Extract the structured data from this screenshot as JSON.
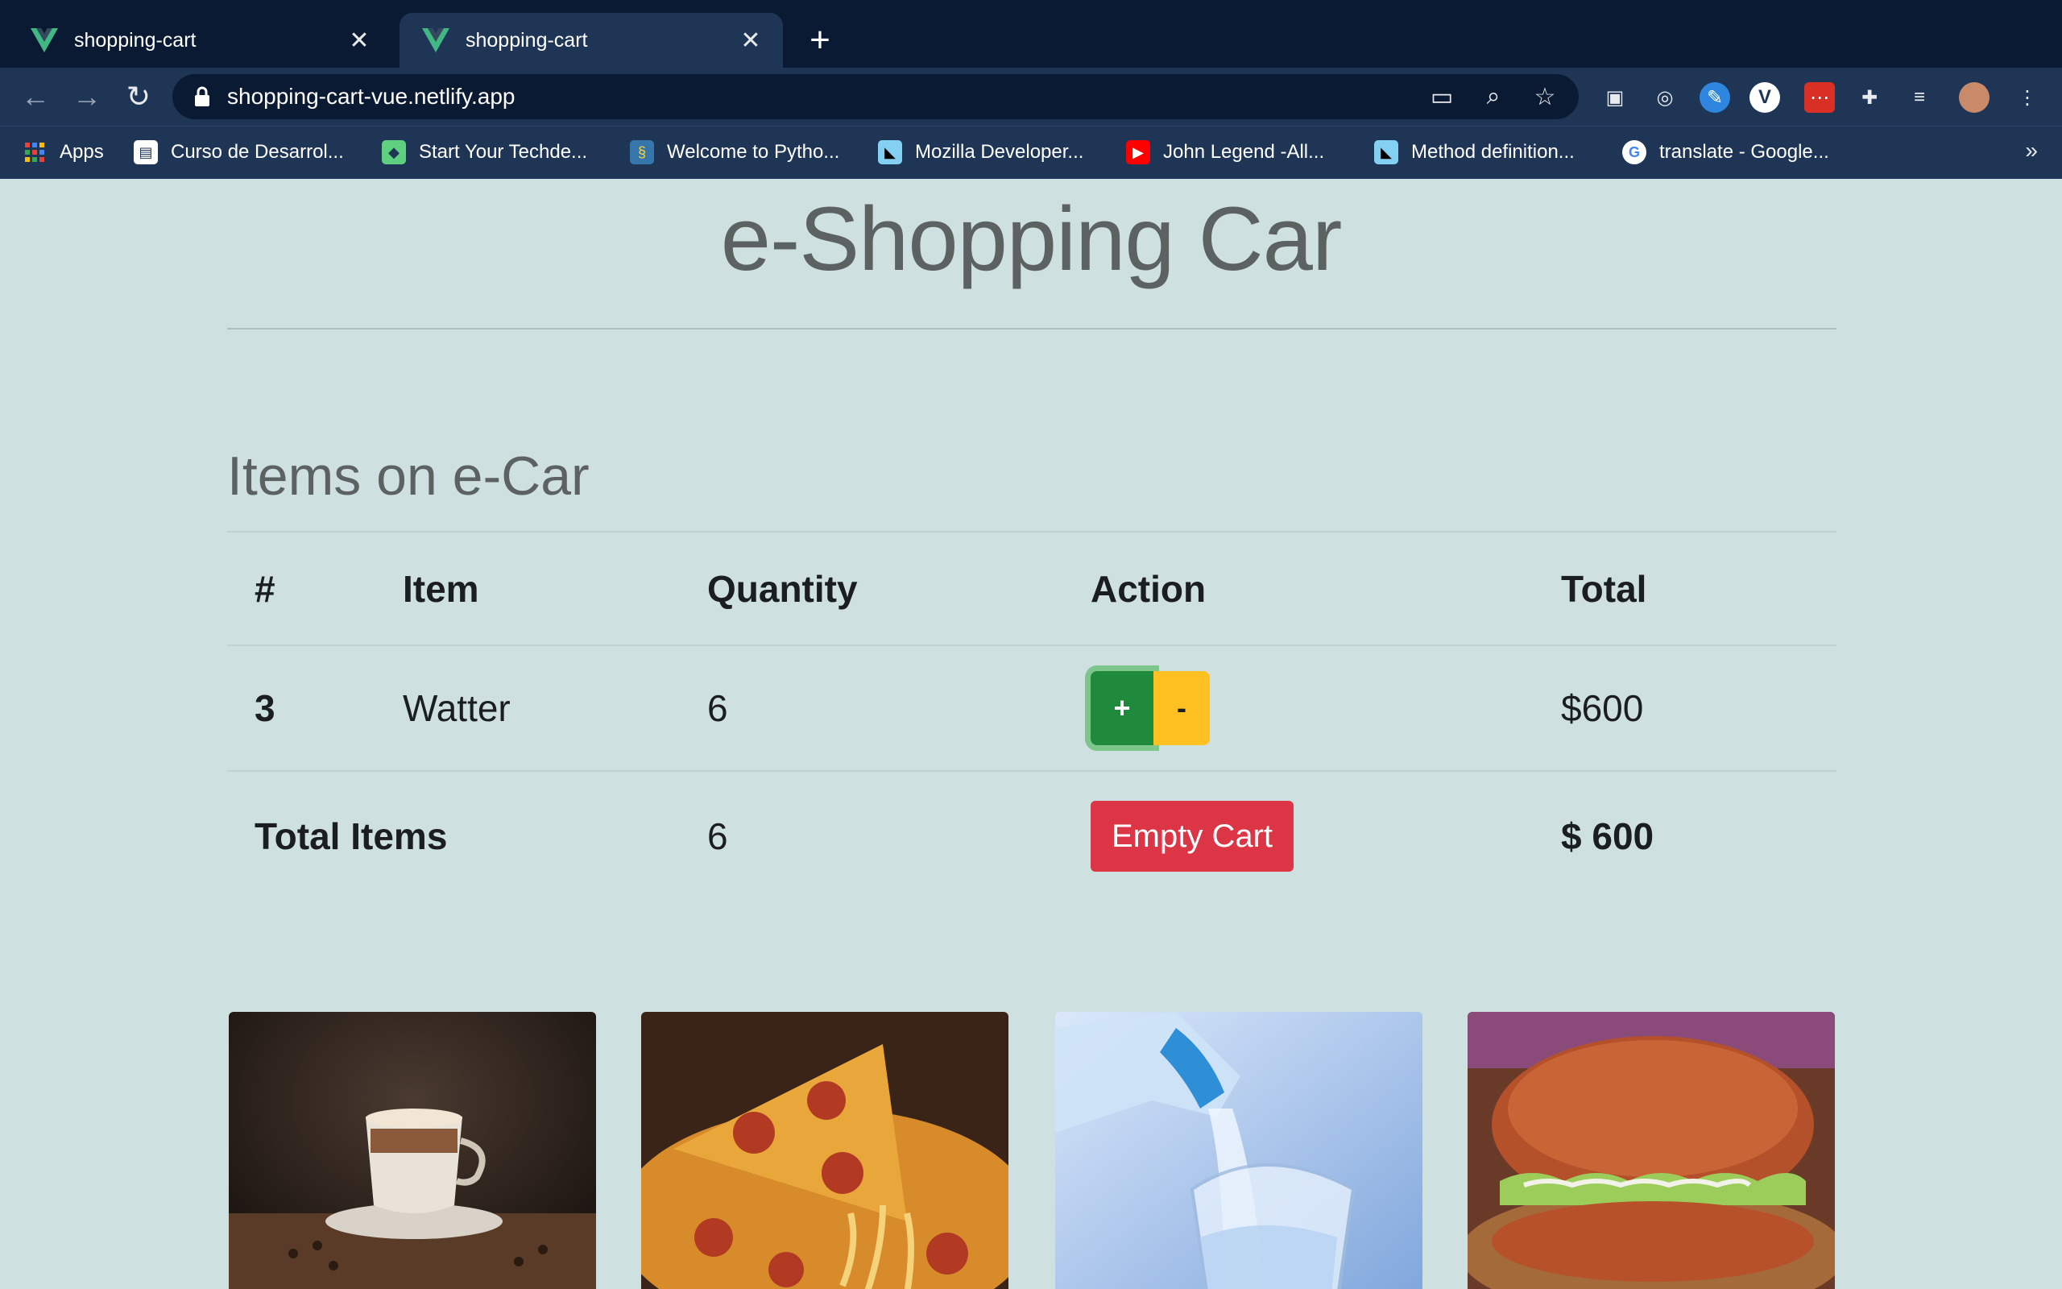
{
  "browser": {
    "tabs": [
      {
        "title": "shopping-cart",
        "active": false
      },
      {
        "title": "shopping-cart",
        "active": true
      }
    ],
    "new_tab_symbol": "+",
    "url": "shopping-cart-vue.netlify.app",
    "bookmarks": [
      {
        "label": "Apps",
        "icon": "apps-grid-icon"
      },
      {
        "label": "Curso de Desarrol...",
        "icon": "bookmark-page-icon"
      },
      {
        "label": "Start Your Techde...",
        "icon": "techdegree-icon"
      },
      {
        "label": "Welcome to Pytho...",
        "icon": "python-icon"
      },
      {
        "label": "Mozilla Developer...",
        "icon": "mdn-icon"
      },
      {
        "label": "John Legend -All...",
        "icon": "youtube-icon"
      },
      {
        "label": "Method definition...",
        "icon": "mdn-icon"
      },
      {
        "label": "translate - Google...",
        "icon": "google-icon"
      }
    ],
    "more_bookmarks": "»"
  },
  "page": {
    "title": "e-Shopping Car",
    "subtitle": "Items on e-Car",
    "table": {
      "headers": [
        "#",
        "Item",
        "Quantity",
        "Action",
        "Total"
      ],
      "row": {
        "id": "3",
        "item": "Watter",
        "quantity": "6",
        "total": "$600"
      },
      "plus_label": "+",
      "minus_label": "-",
      "footer": {
        "label": "Total Items",
        "quantity": "6",
        "empty_label": "Empty Cart",
        "total": "$ 600"
      }
    },
    "products": [
      "coffee-image",
      "pizza-image",
      "water-image",
      "torta-image"
    ]
  },
  "colors": {
    "page_bg": "#cfe0e0",
    "plus_button": "#1f8a3c",
    "minus_button": "#ffc022",
    "empty_button": "#dc3545",
    "chrome_dark": "#0b1a33",
    "chrome_toolbar": "#1e3556"
  }
}
